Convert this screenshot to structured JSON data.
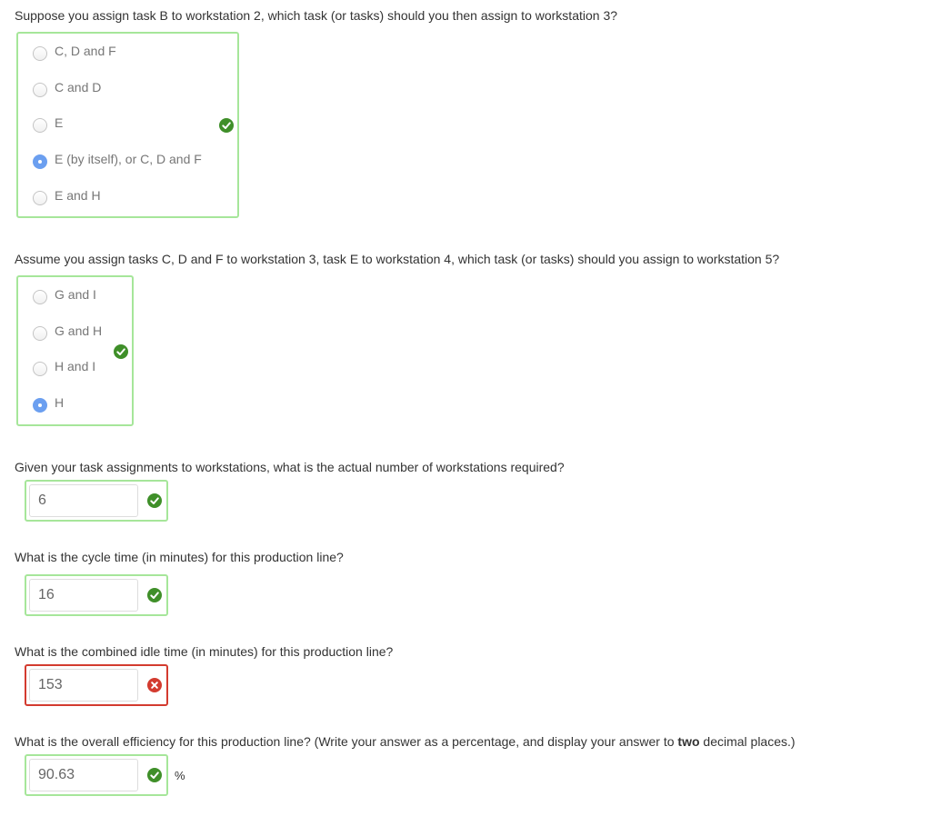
{
  "colors": {
    "correct_border": "#a6e69a",
    "wrong_border": "#d33b2f",
    "correct_icon": "#3f8f29",
    "wrong_icon": "#d33b2f",
    "radio_selected": "#6b9ff0"
  },
  "q1": {
    "text": "Suppose you assign task B to workstation 2, which task (or tasks) should you then assign to workstation 3?",
    "options": [
      "C, D and F",
      "C and D",
      "E",
      "E (by itself), or C, D and F",
      "E and H"
    ],
    "selected_index": 3,
    "status": "correct"
  },
  "q2": {
    "text": "Assume you assign tasks C, D and F to workstation 3, task E to workstation 4, which task (or tasks) should you assign to workstation 5?",
    "options": [
      "G and I",
      "G and H",
      "H and I",
      "H"
    ],
    "selected_index": 3,
    "status": "correct"
  },
  "q3": {
    "text": "Given your task assignments to workstations, what is the actual number of workstations required?",
    "value": "6",
    "status": "correct"
  },
  "q4": {
    "text": "What is the cycle time (in minutes) for this production line?",
    "value": "16",
    "status": "correct"
  },
  "q5": {
    "text": "What is the combined idle time (in minutes) for this production line?",
    "value": "153",
    "status": "wrong"
  },
  "q6": {
    "text_before": "What is the overall efficiency for this production line? (Write your answer as a percentage, and display your answer to ",
    "text_bold": "two",
    "text_after": " decimal places.)",
    "value": "90.63",
    "unit": "%",
    "status": "correct"
  }
}
